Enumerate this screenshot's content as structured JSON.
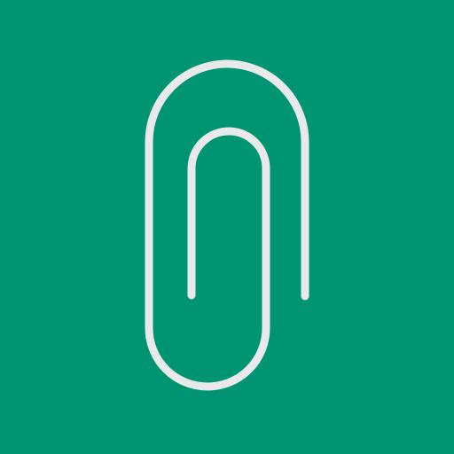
{
  "icon": {
    "name": "paperclip-icon",
    "background_color": "#009572",
    "stroke_color": "#E9E9E9"
  }
}
